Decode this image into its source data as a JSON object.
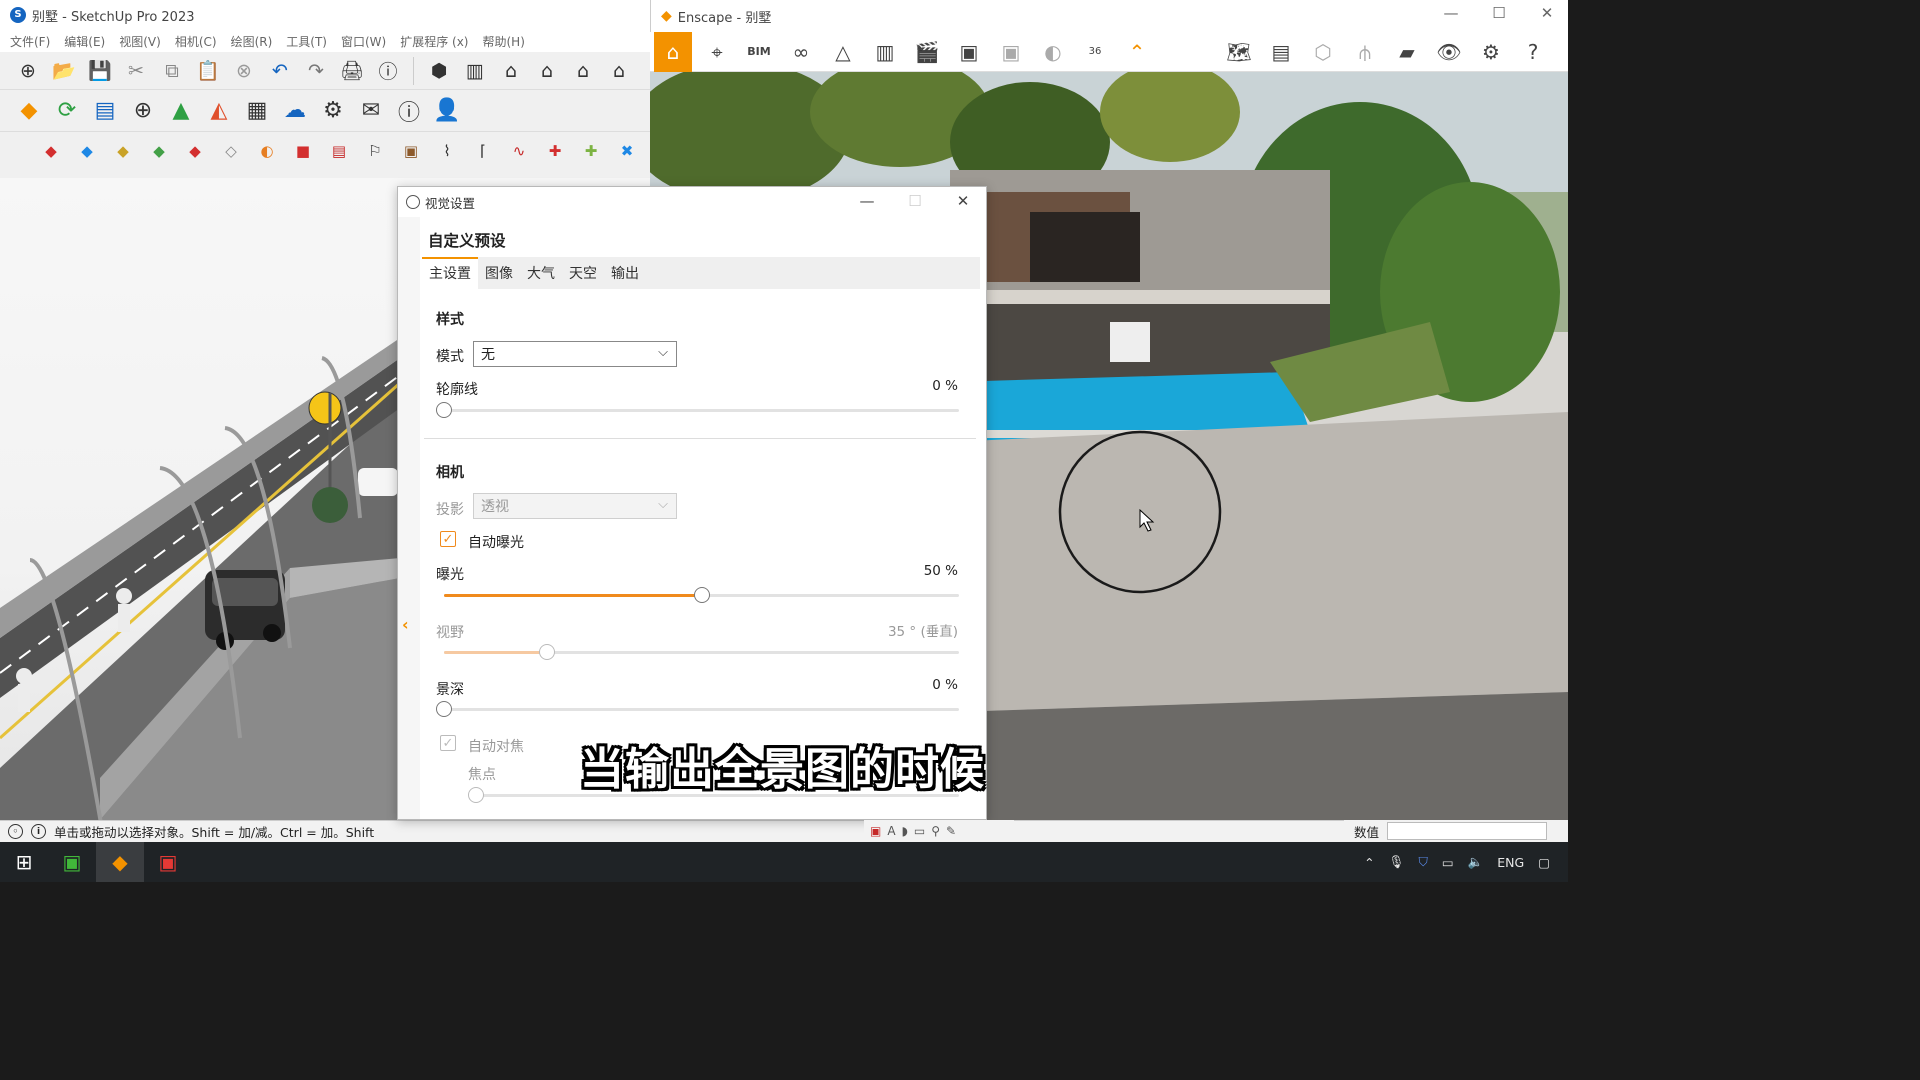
{
  "sketchup": {
    "title": "别墅 - SketchUp Pro 2023",
    "menu": [
      "文件(F)",
      "编辑(E)",
      "视图(V)",
      "相机(C)",
      "绘图(R)",
      "工具(T)",
      "窗口(W)",
      "扩展程序 (x)",
      "帮助(H)"
    ],
    "status_text": "单击或拖动以选择对象。Shift = 加/减。Ctrl = 加。Shift"
  },
  "enscape": {
    "title": "Enscape - 别墅",
    "toolbar_bim": "BIM",
    "toolbar_36": "36"
  },
  "dialog": {
    "title": "视觉设置",
    "preset": "自定义预设",
    "tabs": [
      {
        "label": "主设置",
        "active": true
      },
      {
        "label": "图像",
        "active": false
      },
      {
        "label": "大气",
        "active": false
      },
      {
        "label": "天空",
        "active": false
      },
      {
        "label": "输出",
        "active": false
      }
    ],
    "style": {
      "heading": "样式",
      "mode_label": "模式",
      "mode_value": "无",
      "outline_label": "轮廓线",
      "outline_value": "0",
      "outline_unit": "%"
    },
    "camera": {
      "heading": "相机",
      "projection_label": "投影",
      "projection_value": "透视",
      "auto_exposure_label": "自动曝光",
      "auto_exposure_checked": true,
      "exposure_label": "曝光",
      "exposure_value": "50",
      "exposure_unit": "%",
      "exposure_fraction": 0.5,
      "fov_label": "视野",
      "fov_value": "35",
      "fov_unit": "° (垂直)",
      "fov_fraction": 0.2,
      "dof_label": "景深",
      "dof_value": "0",
      "dof_unit": "%",
      "autofocus_label": "自动对焦",
      "autofocus_checked": true,
      "focus_label": "焦点"
    }
  },
  "measurements_label": "数值",
  "subtitle": "当输出全景图的时候",
  "taskbar": {
    "lang": "ENG"
  },
  "colors": {
    "accent": "#f39200",
    "slider_fill": "#f08a1c",
    "pool": "#1aa7d8"
  }
}
